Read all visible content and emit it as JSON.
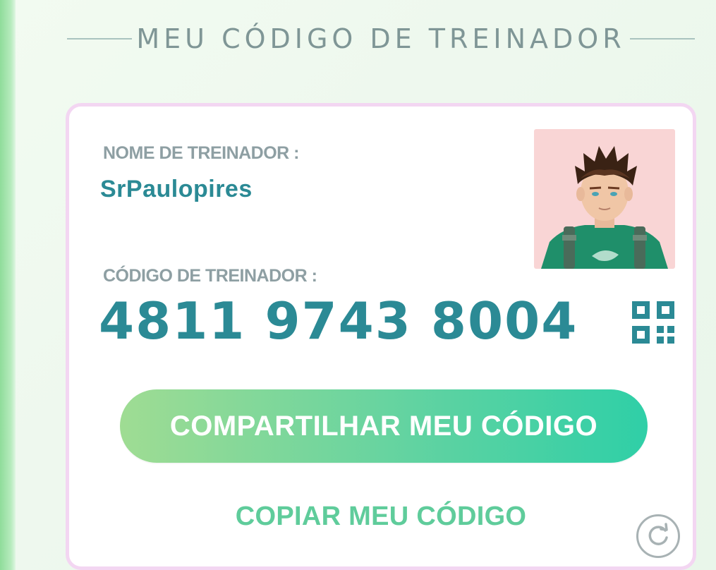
{
  "header": {
    "title": "MEU CÓDIGO DE TREINADOR"
  },
  "card": {
    "name_label": "NOME DE TREINADOR :",
    "name_value": "SrPaulopires",
    "code_label": "CÓDIGO DE TREINADOR :",
    "code_value": "4811 9743 8004",
    "qr_icon": "qr-code-icon",
    "avatar_icon": "trainer-avatar",
    "share_button": "COMPARTILHAR MEU CÓDIGO",
    "copy_button": "COPIAR MEU CÓDIGO",
    "refresh_icon": "refresh-icon"
  },
  "colors": {
    "accent_teal": "#2b8a95",
    "label_gray": "#8e9fa3",
    "card_border": "#f3d6f2",
    "button_start": "#9fdc93",
    "button_end": "#2fcfa7",
    "copy_green": "#5fcc9b",
    "avatar_bg": "#f9d5d5"
  }
}
